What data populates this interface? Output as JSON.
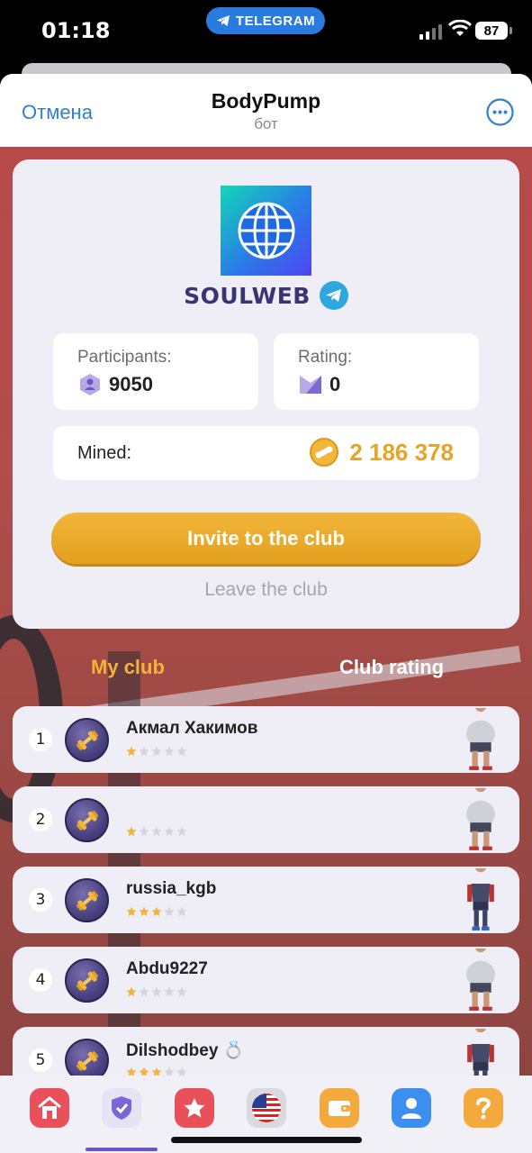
{
  "status_bar": {
    "time": "01:18",
    "pill_label": "TELEGRAM",
    "battery": "87"
  },
  "telegram_header": {
    "cancel_label": "Отмена",
    "title": "BodyPump",
    "subtitle": "бот"
  },
  "club": {
    "name": "SOULWEB",
    "participants_label": "Participants:",
    "participants_value": "9050",
    "rating_label": "Rating:",
    "rating_value": "0",
    "mined_label": "Mined:",
    "mined_value": "2 186 378",
    "invite_label": "Invite to the club",
    "leave_label": "Leave the club"
  },
  "tabs": {
    "my_club": "My club",
    "club_rating": "Club rating"
  },
  "members": [
    {
      "rank": "1",
      "name": "Акмал Хакимов",
      "stars": 1,
      "figure": "heavy"
    },
    {
      "rank": "2",
      "name": "",
      "stars": 1,
      "figure": "heavy"
    },
    {
      "rank": "3",
      "name": "russia_kgb",
      "stars": 3,
      "figure": "athletic"
    },
    {
      "rank": "4",
      "name": "Abdu9227",
      "stars": 1,
      "figure": "heavy"
    },
    {
      "rank": "5",
      "name": "Dilshodbey 💍",
      "stars": 3,
      "figure": "athletic"
    }
  ],
  "bottom_nav": [
    {
      "name": "home-icon",
      "color": "#e9505a"
    },
    {
      "name": "shield-icon",
      "color": "#7a66d6"
    },
    {
      "name": "star-icon",
      "color": "#e9505a"
    },
    {
      "name": "us-flag-icon",
      "color": "#d9d9de"
    },
    {
      "name": "wallet-icon",
      "color": "#f3a93c"
    },
    {
      "name": "profile-icon",
      "color": "#3c8ef0"
    },
    {
      "name": "help-icon",
      "color": "#f3a93c"
    }
  ],
  "colors": {
    "accent_gold": "#f0b43b",
    "link_blue": "#2f80d1",
    "card_bg": "#efeef6"
  }
}
